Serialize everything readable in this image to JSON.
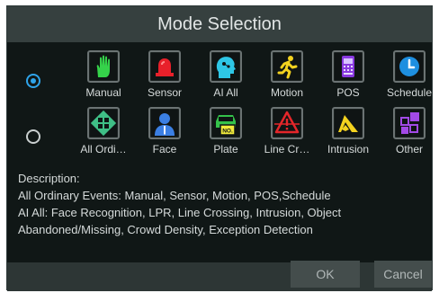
{
  "dialog": {
    "title": "Mode Selection"
  },
  "modes": [
    {
      "checked": true
    },
    {
      "checked": false
    }
  ],
  "row1": [
    {
      "label": "Manual",
      "icon": "hand-icon"
    },
    {
      "label": "Sensor",
      "icon": "alarm-light-icon"
    },
    {
      "label": "AI All",
      "icon": "ai-head-icon"
    },
    {
      "label": "Motion",
      "icon": "running-person-icon"
    },
    {
      "label": "POS",
      "icon": "pos-terminal-icon"
    },
    {
      "label": "Schedule",
      "icon": "clock-icon"
    }
  ],
  "row2": [
    {
      "label": "All Ordi…",
      "icon": "grid-icon"
    },
    {
      "label": "Face",
      "icon": "face-person-icon"
    },
    {
      "label": "Plate",
      "icon": "license-plate-icon"
    },
    {
      "label": "Line Cr…",
      "icon": "line-crossing-icon"
    },
    {
      "label": "Intrusion",
      "icon": "intrusion-icon"
    },
    {
      "label": "Other",
      "icon": "other-squares-icon"
    }
  ],
  "description": {
    "heading": "Description:",
    "line1": "All Ordinary Events: Manual, Sensor, Motion, POS,Schedule",
    "line2": "AI All: Face Recognition, LPR, Line Crossing, Intrusion, Object",
    "line3": "Abandoned/Missing, Crowd Density, Exception Detection"
  },
  "buttons": {
    "ok": "OK",
    "cancel": "Cancel"
  },
  "colors": {
    "accent": "#2fa4ea",
    "title_bar": "#36403f",
    "body_bg": "#101716"
  }
}
